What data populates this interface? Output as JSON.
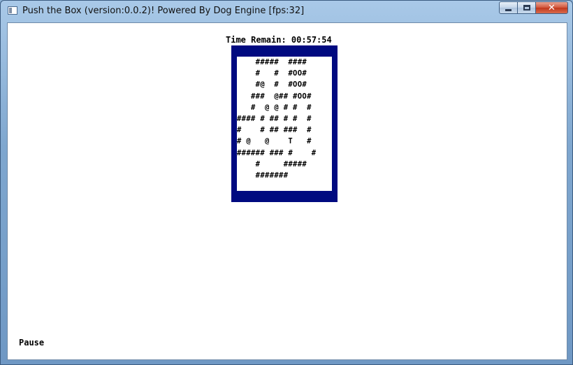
{
  "window": {
    "title": "Push the Box (version:0.0.2)! Powered By Dog Engine [fps:32]",
    "controls": {
      "minimize": "minimize",
      "maximize": "maximize",
      "close": "✕"
    }
  },
  "game": {
    "timer": "Time Remain: 00:57:54",
    "map": "    #####  ####\n    #   #  #OO#\n    #@  #  #OO#\n   ###  @## #OO#\n   #  @ @ # #  #\n#### # ## # #  #\n#    # ## ###  #\n# @   @    T   #\n###### ### #    #\n    #     #####\n    #######",
    "status": "Pause"
  },
  "colors": {
    "board_frame": "#000a80",
    "background": "#ffffff"
  }
}
